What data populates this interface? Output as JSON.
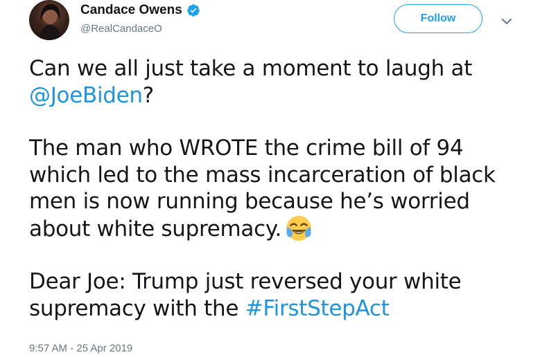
{
  "author": {
    "display_name": "Candace Owens",
    "handle": "@RealCandaceO",
    "verified": true
  },
  "actions": {
    "follow_label": "Follow"
  },
  "tweet": {
    "line1_text": "Can we all just take a moment to laugh at",
    "mention": "@JoeBiden",
    "line1_end": "?",
    "para2_text": "The man who WROTE the crime bill of 94 which led to the mass incarceration of black men is now running because he’s worried about white supremacy.",
    "para3_text": "Dear Joe: Trump just reversed your white supremacy with the",
    "hashtag": "#FirstStepAct",
    "emoji": "face-with-tears-of-joy-icon"
  },
  "meta": {
    "timestamp": "9:57 AM - 25 Apr 2019"
  },
  "colors": {
    "link": "#1b95e0",
    "follow_border": "#1da1f2",
    "secondary_text": "#657786",
    "primary_text": "#14171a"
  }
}
